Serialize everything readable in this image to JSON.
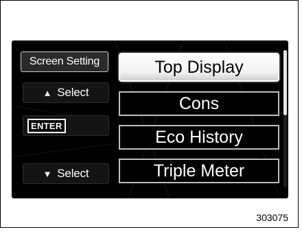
{
  "left_panel": {
    "screen_setting_label": "Screen Setting",
    "select_up_label": "Select",
    "enter_label": "ENTER",
    "select_down_label": "Select"
  },
  "icons": {
    "up_arrow": "triangle-up-icon",
    "down_arrow": "triangle-down-icon"
  },
  "menu": {
    "items": [
      {
        "label": "Top Display",
        "selected": true
      },
      {
        "label": "Cons",
        "selected": false
      },
      {
        "label": "Eco History",
        "selected": false
      },
      {
        "label": "Triple Meter",
        "selected": false
      }
    ]
  },
  "figure_number": "303075",
  "colors": {
    "screen_background": "#000000",
    "selected_item": "#ffffff",
    "item_border": "#bfbfbf"
  }
}
